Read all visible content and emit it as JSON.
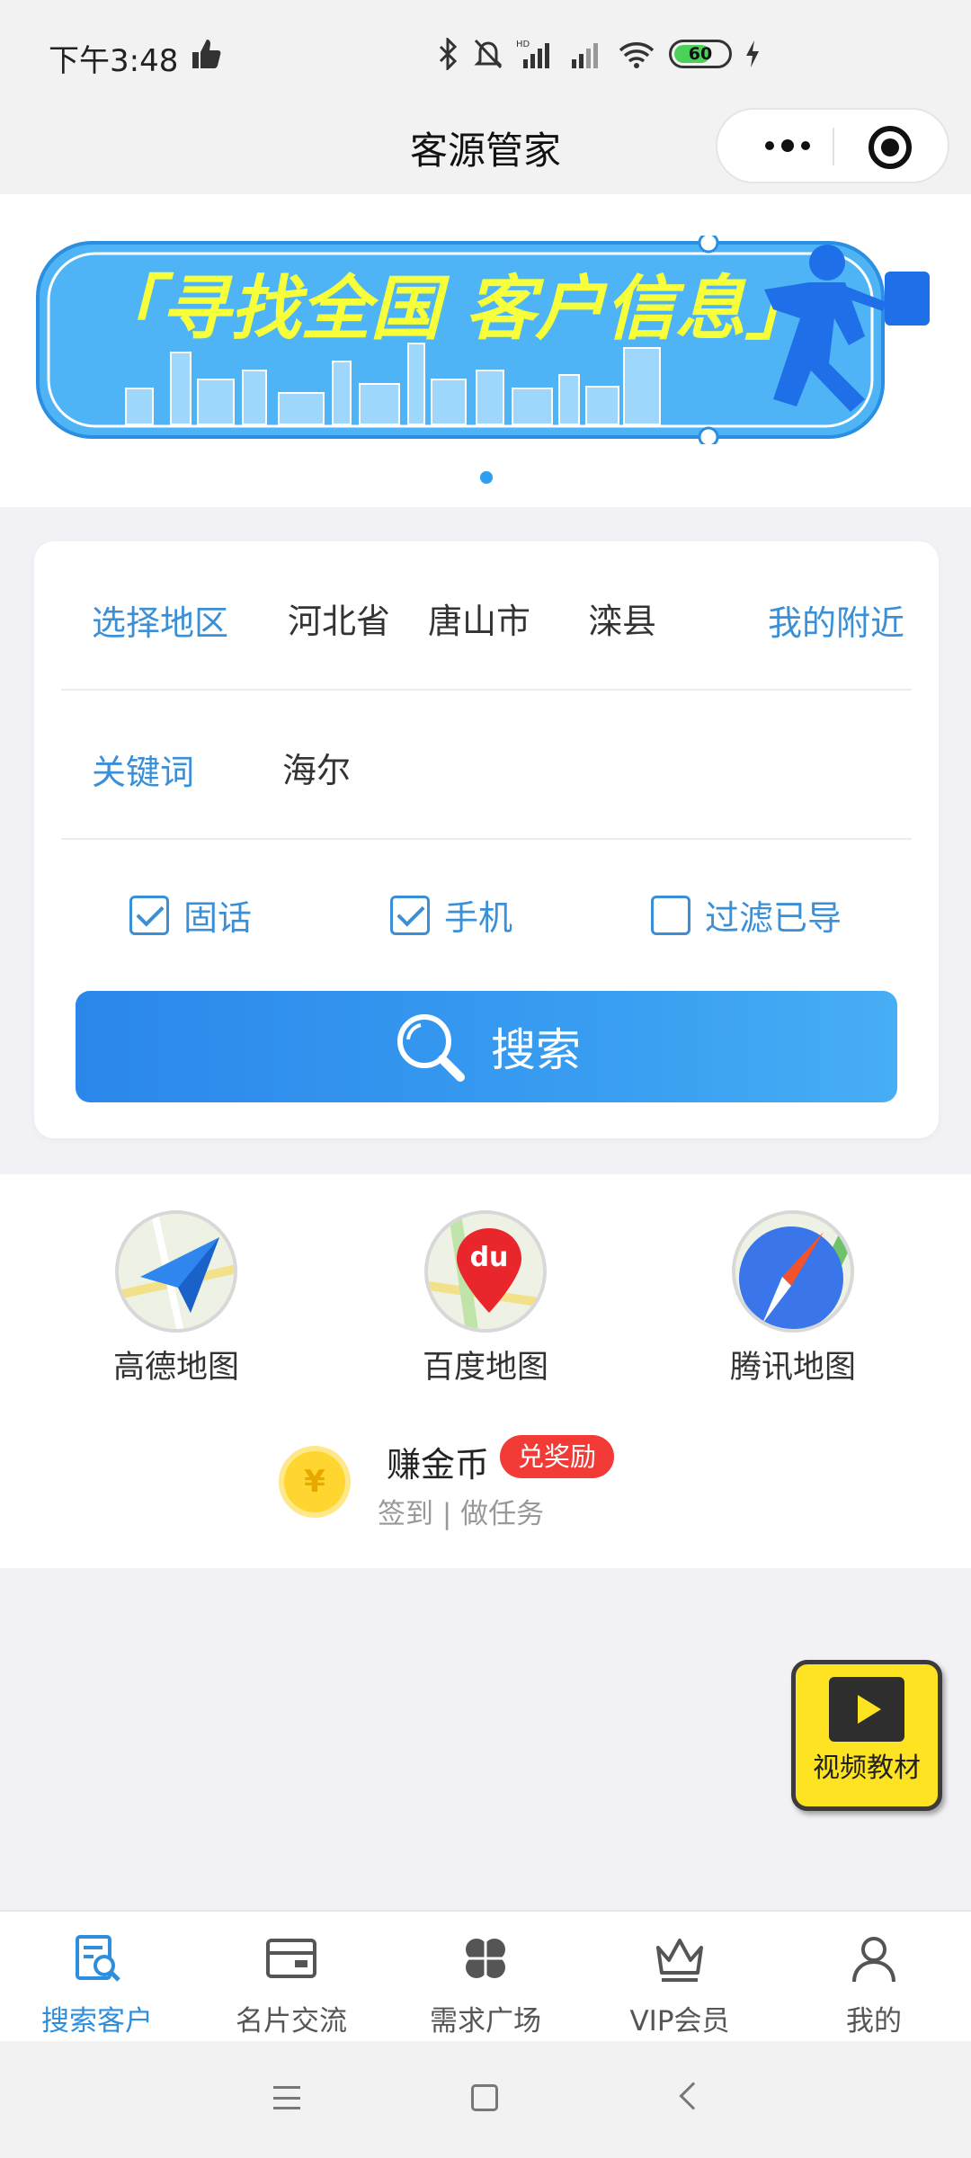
{
  "status_bar": {
    "time": "下午3:48",
    "battery": "60"
  },
  "header": {
    "title": "客源管家"
  },
  "banner": {
    "text": "「寻找全国 客户信息」"
  },
  "form": {
    "region_label": "选择地区",
    "province": "河北省",
    "city": "唐山市",
    "county": "滦县",
    "nearby": "我的附近",
    "keyword_label": "关键词",
    "keyword_value": "海尔",
    "checks": [
      {
        "label": "固话",
        "checked": true
      },
      {
        "label": "手机",
        "checked": true
      },
      {
        "label": "过滤已导",
        "checked": false
      }
    ],
    "search_label": "搜索"
  },
  "maps": [
    {
      "label": "高德地图",
      "icon": "amap-icon"
    },
    {
      "label": "百度地图",
      "icon": "baidu-map-icon"
    },
    {
      "label": "腾讯地图",
      "icon": "tencent-map-icon"
    }
  ],
  "coins": {
    "title": "赚金币",
    "badge": "兑奖励",
    "subtitle": "签到 | 做任务",
    "coin_symbol": "¥"
  },
  "video": {
    "label": "视频教材"
  },
  "tabs": [
    {
      "label": "搜索客户",
      "icon": "search-customer-icon",
      "active": true
    },
    {
      "label": "名片交流",
      "icon": "business-card-icon",
      "active": false
    },
    {
      "label": "需求广场",
      "icon": "clover-icon",
      "active": false
    },
    {
      "label": "VIP会员",
      "icon": "crown-icon",
      "active": false
    },
    {
      "label": "我的",
      "icon": "user-icon",
      "active": false
    }
  ],
  "colors": {
    "accent": "#3a8fd6",
    "button": "#2b87ea",
    "badge": "#f23a36",
    "banner_bg": "#36a3f0",
    "banner_text": "#f6ff3a"
  }
}
